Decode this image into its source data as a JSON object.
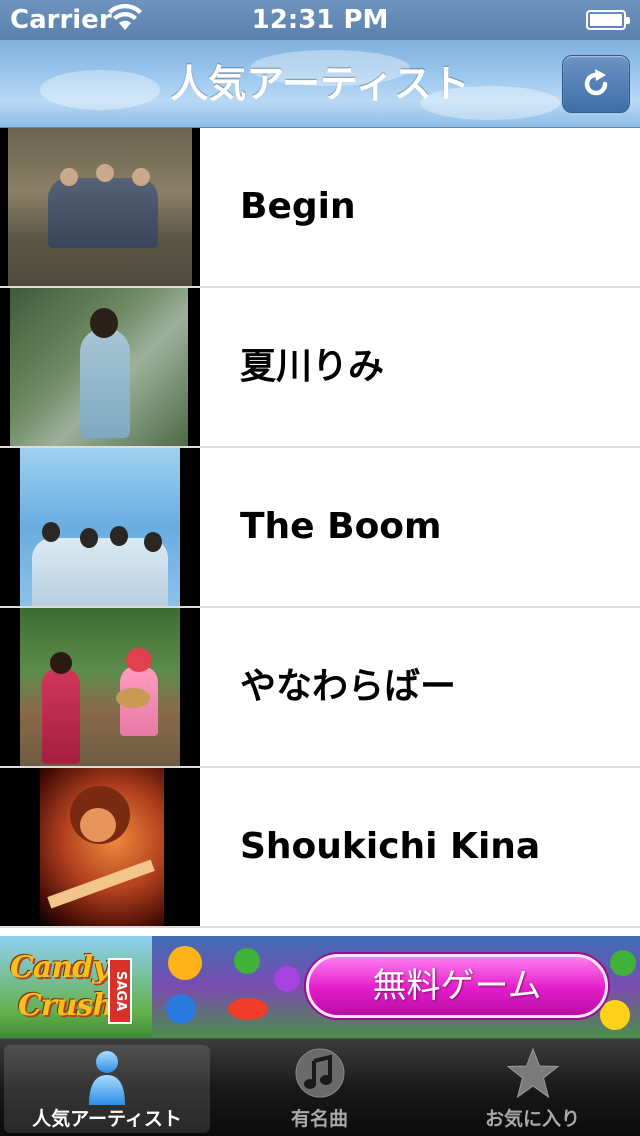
{
  "status_bar": {
    "carrier": "Carrier",
    "time": "12:31 PM"
  },
  "nav": {
    "title": "人気アーティスト",
    "refresh_icon": "refresh-icon"
  },
  "artists": [
    {
      "name": "Begin"
    },
    {
      "name": "夏川りみ"
    },
    {
      "name": "The Boom"
    },
    {
      "name": "やなわらばー"
    },
    {
      "name": "Shoukichi Kina"
    }
  ],
  "ad": {
    "brand_line1": "Candy",
    "brand_line2": "Crush",
    "brand_tag": "SAGA",
    "cta": "無料ゲーム"
  },
  "tab_bar": {
    "tabs": [
      {
        "label": "人気アーティスト",
        "icon": "person-icon",
        "active": true
      },
      {
        "label": "有名曲",
        "icon": "music-note-icon",
        "active": false
      },
      {
        "label": "お気に入り",
        "icon": "star-icon",
        "active": false
      }
    ]
  },
  "colors": {
    "nav_accent": "#8fbde6",
    "ad_cta": "#e21cc9"
  }
}
